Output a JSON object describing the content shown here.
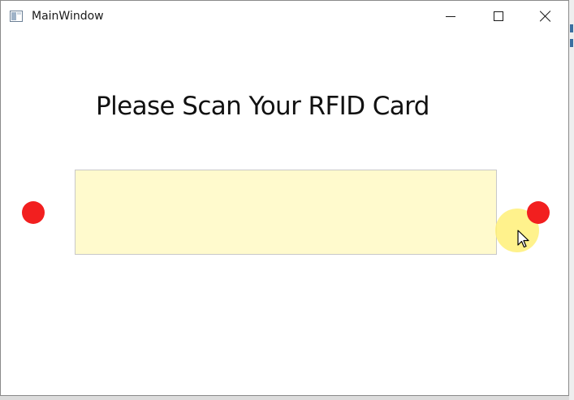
{
  "window": {
    "title": "MainWindow"
  },
  "caption_buttons": {
    "minimize": "minimize-icon",
    "maximize": "maximize-icon",
    "close": "close-icon"
  },
  "main": {
    "heading": "Please Scan Your RFID Card",
    "rfid_input": {
      "value": "",
      "placeholder": ""
    }
  },
  "indicators": {
    "left_status_color": "#f21f1f",
    "right_status_color": "#f21f1f"
  },
  "colors": {
    "input_background": "#fffacd",
    "cursor_highlight": "#fff078"
  }
}
